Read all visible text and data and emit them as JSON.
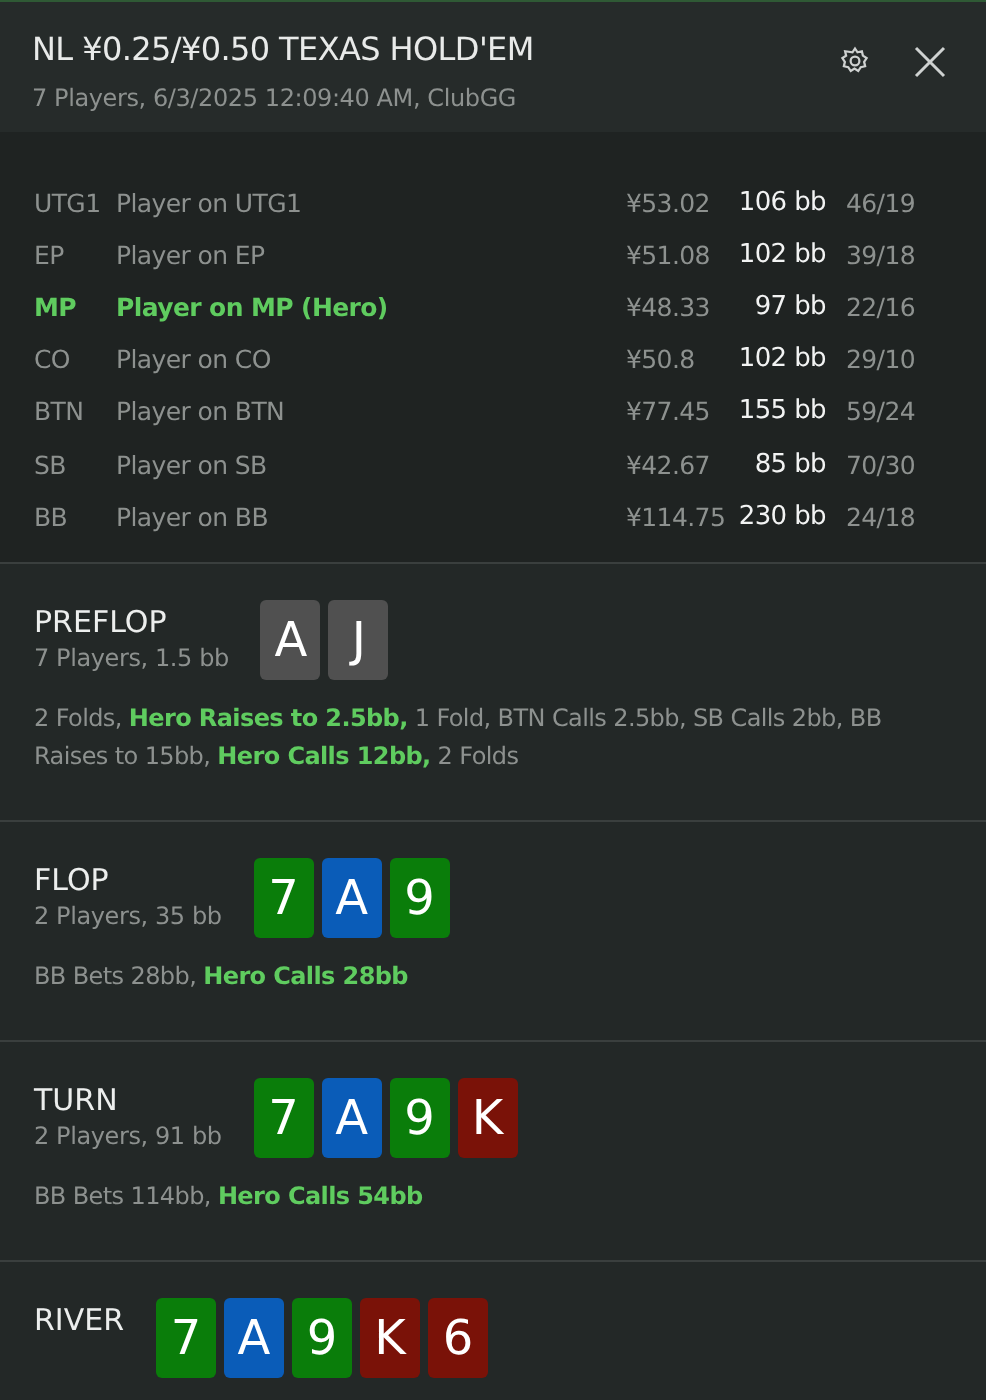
{
  "header": {
    "title": "NL ¥0.25/¥0.50 TEXAS HOLD'EM",
    "subtitle": "7 Players, 6/3/2025 12:09:40 AM, ClubGG"
  },
  "players": [
    {
      "position": "UTG1",
      "name": "Player on UTG1",
      "stack": "¥53.02",
      "bb": "106 bb",
      "stats": "46/19",
      "hero": false
    },
    {
      "position": "EP",
      "name": "Player on EP",
      "stack": "¥51.08",
      "bb": "102 bb",
      "stats": "39/18",
      "hero": false
    },
    {
      "position": "MP",
      "name": "Player on MP (Hero)",
      "stack": "¥48.33",
      "bb": "97 bb",
      "stats": "22/16",
      "hero": true
    },
    {
      "position": "CO",
      "name": "Player on CO",
      "stack": "¥50.8",
      "bb": "102 bb",
      "stats": "29/10",
      "hero": false
    },
    {
      "position": "BTN",
      "name": "Player on BTN",
      "stack": "¥77.45",
      "bb": "155 bb",
      "stats": "59/24",
      "hero": false
    },
    {
      "position": "SB",
      "name": "Player on SB",
      "stack": "¥42.67",
      "bb": "85 bb",
      "stats": "70/30",
      "hero": false
    },
    {
      "position": "BB",
      "name": "Player on BB",
      "stack": "¥114.75",
      "bb": "230 bb",
      "stats": "24/18",
      "hero": false
    }
  ],
  "streets": [
    {
      "name": "PREFLOP",
      "info": "7 Players, 1.5 bb",
      "cards": [
        {
          "rank": "A",
          "color": "#505050"
        },
        {
          "rank": "J",
          "color": "#505050"
        }
      ],
      "actions": "2 Folds, **Hero Raises to 2.5bb,** 1 Fold, BTN Calls 2.5bb, SB Calls 2bb, BB Raises to 15bb, **Hero Calls 12bb,** 2 Folds"
    },
    {
      "name": "FLOP",
      "info": "2 Players, 35 bb",
      "cards": [
        {
          "rank": "7",
          "color": "#0a7d0a"
        },
        {
          "rank": "A",
          "color": "#0a5cb8"
        },
        {
          "rank": "9",
          "color": "#0a7d0a"
        }
      ],
      "actions": "BB Bets 28bb, **Hero Calls 28bb**"
    },
    {
      "name": "TURN",
      "info": "2 Players, 91 bb",
      "cards": [
        {
          "rank": "7",
          "color": "#0a7d0a"
        },
        {
          "rank": "A",
          "color": "#0a5cb8"
        },
        {
          "rank": "9",
          "color": "#0a7d0a"
        },
        {
          "rank": "K",
          "color": "#7a1208"
        }
      ],
      "actions": "BB Bets 114bb, **Hero Calls 54bb**"
    },
    {
      "name": "RIVER",
      "cards": [
        {
          "rank": "7",
          "color": "#0a7d0a"
        },
        {
          "rank": "A",
          "color": "#0a5cb8"
        },
        {
          "rank": "9",
          "color": "#0a7d0a"
        },
        {
          "rank": "K",
          "color": "#7a1208"
        },
        {
          "rank": "6",
          "color": "#7a1208"
        }
      ]
    }
  ]
}
